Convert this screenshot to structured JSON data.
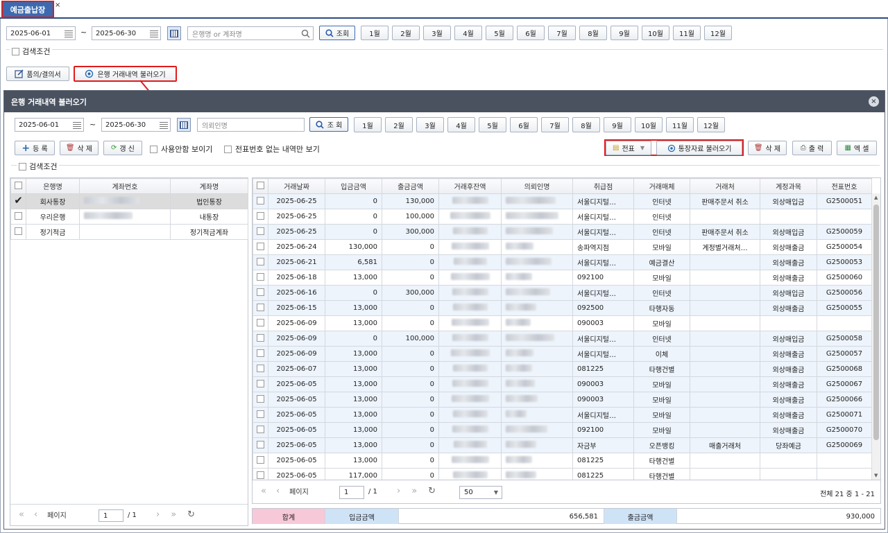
{
  "tab": {
    "title": "예금출납장",
    "close": "×"
  },
  "top": {
    "date_from": "2025-06-01",
    "tilde": "~",
    "date_to": "2025-06-30",
    "search_placeholder": "은행명 or 계좌명",
    "search_btn": "조회",
    "months": [
      "1월",
      "2월",
      "3월",
      "4월",
      "5월",
      "6월",
      "7월",
      "8월",
      "9월",
      "10월",
      "11월",
      "12월"
    ],
    "search_cond": "검색조건",
    "approval_btn": "품의/결의서",
    "bank_import_btn": "은행 거래내역 불러오기"
  },
  "modal": {
    "title": "은행 거래내역 불러오기",
    "date_from": "2025-06-01",
    "tilde": "~",
    "date_to": "2025-06-30",
    "payer_placeholder": "의뢰인명",
    "search_btn": "조 회",
    "months": [
      "1월",
      "2월",
      "3월",
      "4월",
      "5월",
      "6월",
      "7월",
      "8월",
      "9월",
      "10월",
      "11월",
      "12월"
    ],
    "register_btn": "등 록",
    "delete_btn": "삭 제",
    "refresh_btn": "갱 신",
    "show_unused": "사용안함 보이기",
    "show_no_voucher": "전표번호 없는 내역만 보기",
    "voucher_btn": "전표",
    "passbook_btn": "통장자료 불러오기",
    "delete2_btn": "삭 제",
    "print_btn": "출 력",
    "excel_btn": "엑 셀",
    "search_cond": "검색조건",
    "left_headers": [
      "은행명",
      "계좌번호",
      "계좌명"
    ],
    "accounts": [
      {
        "bank": "회사통장",
        "name": "법인통장",
        "checked": true
      },
      {
        "bank": "우리은행",
        "name": "내통장",
        "checked": false
      },
      {
        "bank": "정기적금",
        "name": "정기적금계좌",
        "checked": false
      }
    ],
    "headers": [
      "거래날짜",
      "입금금액",
      "출금금액",
      "거래후잔액",
      "의뢰인명",
      "취급점",
      "거래매체",
      "거래처",
      "계정과목",
      "전표번호"
    ],
    "rows": [
      [
        "2025-06-25",
        "0",
        "130,000",
        "서울디지털…",
        "인터넷",
        "판매주문서 취소",
        "외상매입금",
        "G2500051"
      ],
      [
        "2025-06-25",
        "0",
        "100,000",
        "서울디지털…",
        "인터넷",
        "",
        "",
        ""
      ],
      [
        "2025-06-25",
        "0",
        "300,000",
        "서울디지털…",
        "인터넷",
        "판매주문서 취소",
        "외상매입금",
        "G2500059"
      ],
      [
        "2025-06-24",
        "130,000",
        "0",
        "송파역지점",
        "모바일",
        "계정별거래처…",
        "외상매출금",
        "G2500054"
      ],
      [
        "2025-06-21",
        "6,581",
        "0",
        "서울디지털…",
        "예금결산",
        "",
        "외상매출금",
        "G2500053"
      ],
      [
        "2025-06-18",
        "13,000",
        "0",
        "092100",
        "모바일",
        "",
        "외상매출금",
        "G2500060"
      ],
      [
        "2025-06-16",
        "0",
        "300,000",
        "서울디지털…",
        "인터넷",
        "",
        "외상매입금",
        "G2500056"
      ],
      [
        "2025-06-15",
        "13,000",
        "0",
        "092500",
        "타행자동",
        "",
        "외상매출금",
        "G2500055"
      ],
      [
        "2025-06-09",
        "13,000",
        "0",
        "090003",
        "모바일",
        "",
        "",
        ""
      ],
      [
        "2025-06-09",
        "0",
        "100,000",
        "서울디지털…",
        "인터넷",
        "",
        "외상매입금",
        "G2500058"
      ],
      [
        "2025-06-09",
        "13,000",
        "0",
        "서울디지털…",
        "이체",
        "",
        "외상매출금",
        "G2500057"
      ],
      [
        "2025-06-07",
        "13,000",
        "0",
        "081225",
        "타행건별",
        "",
        "외상매출금",
        "G2500068"
      ],
      [
        "2025-06-05",
        "13,000",
        "0",
        "090003",
        "모바일",
        "",
        "외상매출금",
        "G2500067"
      ],
      [
        "2025-06-05",
        "13,000",
        "0",
        "090003",
        "모바일",
        "",
        "외상매출금",
        "G2500066"
      ],
      [
        "2025-06-05",
        "13,000",
        "0",
        "서울디지털…",
        "모바일",
        "",
        "외상매출금",
        "G2500071"
      ],
      [
        "2025-06-05",
        "13,000",
        "0",
        "092100",
        "모바일",
        "",
        "외상매출금",
        "G2500070"
      ],
      [
        "2025-06-05",
        "13,000",
        "0",
        "자금부",
        "오픈뱅킹",
        "매출거래처",
        "당좌예금",
        "G2500069"
      ],
      [
        "2025-06-05",
        "13,000",
        "0",
        "081225",
        "타행건별",
        "",
        "",
        ""
      ],
      [
        "2025-06-05",
        "117,000",
        "0",
        "081225",
        "타행건별",
        "",
        "",
        ""
      ]
    ],
    "pager": {
      "page_label": "페이지",
      "page": "1",
      "of": "/ 1",
      "page_size": "50",
      "total": "전체 21 중 1 - 21"
    },
    "left_pager": {
      "page_label": "페이지",
      "page": "1",
      "of": "/ 1"
    },
    "summary": {
      "label": "합계",
      "deposit_label": "입금금액",
      "deposit": "656,581",
      "withdraw_label": "출금금액",
      "withdraw": "930,000"
    }
  }
}
